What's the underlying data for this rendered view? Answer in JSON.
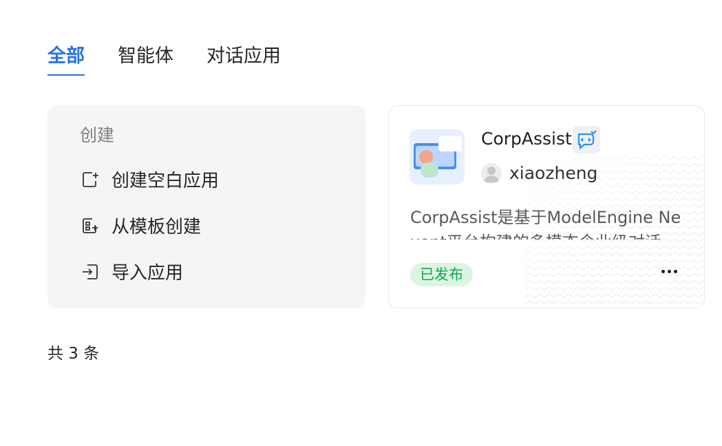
{
  "tabs": [
    {
      "label": "全部",
      "active": true
    },
    {
      "label": "智能体",
      "active": false
    },
    {
      "label": "对话应用",
      "active": false
    }
  ],
  "create_panel": {
    "title": "创建",
    "items": [
      {
        "label": "创建空白应用",
        "icon": "blank-file-plus-icon"
      },
      {
        "label": "从模板创建",
        "icon": "template-plus-icon"
      },
      {
        "label": "导入应用",
        "icon": "import-icon"
      }
    ]
  },
  "app_card": {
    "name": "CorpAssist",
    "type_icon": "chat-bot-icon",
    "author": "xiaozheng",
    "description": "CorpAssist是基于ModelEngine Nexent平台构建的多模态企业级对话",
    "status": "已发布",
    "colors": {
      "status_bg": "#dcf5e3",
      "status_text": "#14a44d",
      "accent": "#2673e5"
    }
  },
  "footer": {
    "total": "共 3 条"
  }
}
